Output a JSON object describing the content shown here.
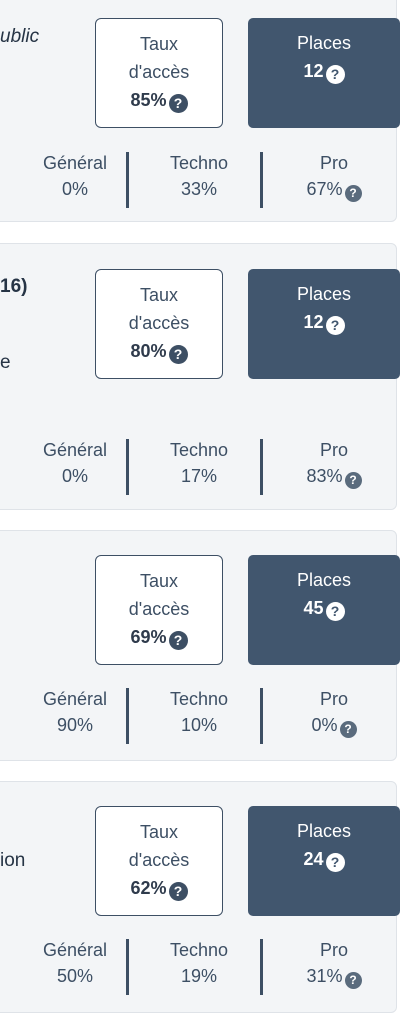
{
  "cards": [
    {
      "left_lines": [
        "ublic"
      ],
      "taux": {
        "label1": "Taux",
        "label2": "d'accès",
        "value": "85%"
      },
      "places": {
        "label": "Places",
        "value": "12"
      },
      "stats": {
        "general": {
          "label": "Général",
          "value": "0%"
        },
        "techno": {
          "label": "Techno",
          "value": "33%"
        },
        "pro": {
          "label": "Pro",
          "value": "67%"
        }
      }
    },
    {
      "left_lines": [
        "16)",
        "e"
      ],
      "taux": {
        "label1": "Taux",
        "label2": "d'accès",
        "value": "80%"
      },
      "places": {
        "label": "Places",
        "value": "12"
      },
      "stats": {
        "general": {
          "label": "Général",
          "value": "0%"
        },
        "techno": {
          "label": "Techno",
          "value": "17%"
        },
        "pro": {
          "label": "Pro",
          "value": "83%"
        }
      }
    },
    {
      "left_lines": [],
      "taux": {
        "label1": "Taux",
        "label2": "d'accès",
        "value": "69%"
      },
      "places": {
        "label": "Places",
        "value": "45"
      },
      "stats": {
        "general": {
          "label": "Général",
          "value": "90%"
        },
        "techno": {
          "label": "Techno",
          "value": "10%"
        },
        "pro": {
          "label": "Pro",
          "value": "0%"
        }
      }
    },
    {
      "left_lines": [
        "ion"
      ],
      "taux": {
        "label1": "Taux",
        "label2": "d'accès",
        "value": "62%"
      },
      "places": {
        "label": "Places",
        "value": "24"
      },
      "stats": {
        "general": {
          "label": "Général",
          "value": "50%"
        },
        "techno": {
          "label": "Techno",
          "value": "19%"
        },
        "pro": {
          "label": "Pro",
          "value": "31%"
        }
      }
    }
  ],
  "help_icon": {
    "glyph": "?",
    "name": "question-circle-icon"
  }
}
